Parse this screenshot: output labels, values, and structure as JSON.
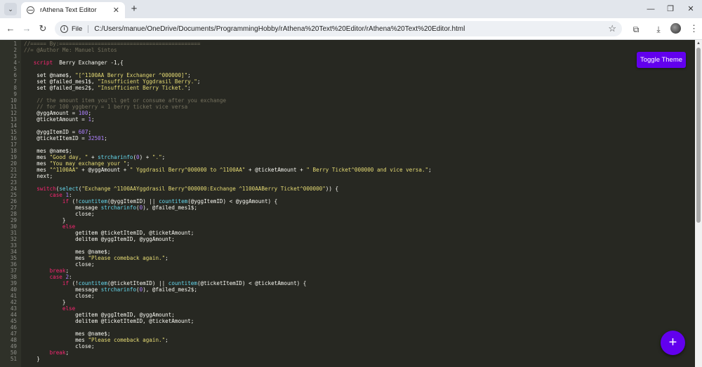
{
  "browser": {
    "tab_title": "rAthena Text Editor",
    "url_scheme": "File",
    "url": "C:/Users/manue/OneDrive/Documents/ProgrammingHobby/rAthena%20Text%20Editor/rAthena%20Text%20Editor.html",
    "tab_close": "✕",
    "new_tab": "+",
    "minimize": "—",
    "restore": "❐",
    "close": "✕",
    "back": "←",
    "forward": "→",
    "reload": "↻",
    "star": "☆",
    "extensions": "⧉",
    "downloads": "⤓",
    "menu": "⋮",
    "tab_search": "⌄",
    "info": "i"
  },
  "editor": {
    "toggle_theme_label": "Toggle Theme",
    "fab_label": "+",
    "scroll_up": "▲",
    "lines": [
      {
        "n": "1",
        "t": [
          [
            "c-comment",
            "//===== By:============================================"
          ]
        ]
      },
      {
        "n": "2",
        "t": [
          [
            "c-comment",
            "//= @Author Me: Manuel Sintos"
          ]
        ]
      },
      {
        "n": "3",
        "t": []
      },
      {
        "n": "4",
        "fold": "-",
        "t": [
          [
            "c-var",
            "   "
          ],
          [
            "c-kw",
            "script"
          ],
          [
            "c-var",
            "  Berry Exchanger -1,{"
          ]
        ]
      },
      {
        "n": "5",
        "t": []
      },
      {
        "n": "6",
        "t": [
          [
            "c-var",
            "    set @name$, "
          ],
          [
            "c-str",
            "\"[^1100AA Berry Exchanger ^000000]\""
          ],
          [
            "c-var",
            ";"
          ]
        ]
      },
      {
        "n": "7",
        "t": [
          [
            "c-var",
            "    set @failed_mes1$, "
          ],
          [
            "c-str",
            "\"Insufficient Yggdrasil Berry.\""
          ],
          [
            "c-var",
            ";"
          ]
        ]
      },
      {
        "n": "8",
        "t": [
          [
            "c-var",
            "    set @failed_mes2$, "
          ],
          [
            "c-str",
            "\"Insufficient Berry Ticket.\""
          ],
          [
            "c-var",
            ";"
          ]
        ]
      },
      {
        "n": "9",
        "t": []
      },
      {
        "n": "10",
        "t": [
          [
            "c-comment",
            "    // the amount item you'll get or consume after you exchange"
          ]
        ]
      },
      {
        "n": "11",
        "t": [
          [
            "c-comment",
            "    // for 100 yggberry = 1 berry ticket vice versa"
          ]
        ]
      },
      {
        "n": "12",
        "t": [
          [
            "c-var",
            "    @yggAmount = "
          ],
          [
            "c-num",
            "100"
          ],
          [
            "c-var",
            ";"
          ]
        ]
      },
      {
        "n": "13",
        "t": [
          [
            "c-var",
            "    @ticketAmount = "
          ],
          [
            "c-num",
            "1"
          ],
          [
            "c-var",
            ";"
          ]
        ]
      },
      {
        "n": "14",
        "t": []
      },
      {
        "n": "15",
        "t": [
          [
            "c-var",
            "    @yggItemID = "
          ],
          [
            "c-num",
            "607"
          ],
          [
            "c-var",
            ";"
          ]
        ]
      },
      {
        "n": "16",
        "t": [
          [
            "c-var",
            "    @ticketItemID = "
          ],
          [
            "c-num",
            "32501"
          ],
          [
            "c-var",
            ";"
          ]
        ]
      },
      {
        "n": "17",
        "t": []
      },
      {
        "n": "18",
        "t": [
          [
            "c-var",
            "    mes @name$;"
          ]
        ]
      },
      {
        "n": "19",
        "t": [
          [
            "c-var",
            "    mes "
          ],
          [
            "c-str",
            "\"Good day, \""
          ],
          [
            "c-var",
            " + "
          ],
          [
            "c-func",
            "strcharinfo"
          ],
          [
            "c-var",
            "("
          ],
          [
            "c-num",
            "0"
          ],
          [
            "c-var",
            ") + "
          ],
          [
            "c-str",
            "\".\""
          ],
          [
            "c-var",
            ";"
          ]
        ]
      },
      {
        "n": "20",
        "t": [
          [
            "c-var",
            "    mes "
          ],
          [
            "c-str",
            "\"You may exchange your \""
          ],
          [
            "c-var",
            ";"
          ]
        ]
      },
      {
        "n": "21",
        "t": [
          [
            "c-var",
            "    mes "
          ],
          [
            "c-str",
            "\"^1100AA\""
          ],
          [
            "c-var",
            " + @yggAmount + "
          ],
          [
            "c-str",
            "\" Yggdrasil Berry^000000 to ^1100AA\""
          ],
          [
            "c-var",
            " + @ticketAmount + "
          ],
          [
            "c-str",
            "\" Berry Ticket^000000 and vice versa.\""
          ],
          [
            "c-var",
            ";"
          ]
        ]
      },
      {
        "n": "22",
        "t": [
          [
            "c-var",
            "    next;"
          ]
        ]
      },
      {
        "n": "23",
        "t": []
      },
      {
        "n": "24",
        "t": [
          [
            "c-var",
            "    "
          ],
          [
            "c-kw",
            "switch"
          ],
          [
            "c-var",
            "("
          ],
          [
            "c-func",
            "select"
          ],
          [
            "c-var",
            "("
          ],
          [
            "c-str",
            "\"Exchange ^1100AAYggdrasil Berry^000000:Exchange ^1100AABerry Ticket^000000\""
          ],
          [
            "c-var",
            ")) {"
          ]
        ]
      },
      {
        "n": "25",
        "t": [
          [
            "c-var",
            "        "
          ],
          [
            "c-kw",
            "case"
          ],
          [
            "c-var",
            " "
          ],
          [
            "c-num",
            "1"
          ],
          [
            "c-var",
            ":"
          ]
        ]
      },
      {
        "n": "26",
        "t": [
          [
            "c-var",
            "            "
          ],
          [
            "c-kw",
            "if"
          ],
          [
            "c-var",
            " (!"
          ],
          [
            "c-func",
            "countitem"
          ],
          [
            "c-var",
            "(@yggItemID) || "
          ],
          [
            "c-func",
            "countitem"
          ],
          [
            "c-var",
            "(@yggItemID) < @yggAmount) {"
          ]
        ]
      },
      {
        "n": "27",
        "t": [
          [
            "c-var",
            "                message "
          ],
          [
            "c-func",
            "strcharinfo"
          ],
          [
            "c-var",
            "("
          ],
          [
            "c-num",
            "0"
          ],
          [
            "c-var",
            "), @failed_mes1$;"
          ]
        ]
      },
      {
        "n": "28",
        "t": [
          [
            "c-var",
            "                close;"
          ]
        ]
      },
      {
        "n": "29",
        "t": [
          [
            "c-var",
            "            }"
          ]
        ]
      },
      {
        "n": "30",
        "t": [
          [
            "c-var",
            "            "
          ],
          [
            "c-kw",
            "else"
          ]
        ]
      },
      {
        "n": "31",
        "t": [
          [
            "c-var",
            "                getitem @ticketItemID, @ticketAmount;"
          ]
        ]
      },
      {
        "n": "32",
        "t": [
          [
            "c-var",
            "                delitem @yggItemID, @yggAmount;"
          ]
        ]
      },
      {
        "n": "33",
        "t": []
      },
      {
        "n": "34",
        "t": [
          [
            "c-var",
            "                mes @name$;"
          ]
        ]
      },
      {
        "n": "35",
        "t": [
          [
            "c-var",
            "                mes "
          ],
          [
            "c-str",
            "\"Please comeback again.\""
          ],
          [
            "c-var",
            ";"
          ]
        ]
      },
      {
        "n": "36",
        "t": [
          [
            "c-var",
            "                close;"
          ]
        ]
      },
      {
        "n": "37",
        "t": [
          [
            "c-var",
            "        "
          ],
          [
            "c-kw",
            "break"
          ],
          [
            "c-var",
            ";"
          ]
        ]
      },
      {
        "n": "38",
        "t": [
          [
            "c-var",
            "        "
          ],
          [
            "c-kw",
            "case"
          ],
          [
            "c-var",
            " "
          ],
          [
            "c-num",
            "2"
          ],
          [
            "c-var",
            ":"
          ]
        ]
      },
      {
        "n": "39",
        "t": [
          [
            "c-var",
            "            "
          ],
          [
            "c-kw",
            "if"
          ],
          [
            "c-var",
            " (!"
          ],
          [
            "c-func",
            "countitem"
          ],
          [
            "c-var",
            "(@ticketItemID) || "
          ],
          [
            "c-func",
            "countitem"
          ],
          [
            "c-var",
            "(@ticketItemID) < @ticketAmount) {"
          ]
        ]
      },
      {
        "n": "40",
        "t": [
          [
            "c-var",
            "                message "
          ],
          [
            "c-func",
            "strcharinfo"
          ],
          [
            "c-var",
            "("
          ],
          [
            "c-num",
            "0"
          ],
          [
            "c-var",
            "), @failed_mes2$;"
          ]
        ]
      },
      {
        "n": "41",
        "t": [
          [
            "c-var",
            "                close;"
          ]
        ]
      },
      {
        "n": "42",
        "t": [
          [
            "c-var",
            "            }"
          ]
        ]
      },
      {
        "n": "43",
        "t": [
          [
            "c-var",
            "            "
          ],
          [
            "c-kw",
            "else"
          ]
        ]
      },
      {
        "n": "44",
        "t": [
          [
            "c-var",
            "                getitem @yggItemID, @yggAmount;"
          ]
        ]
      },
      {
        "n": "45",
        "t": [
          [
            "c-var",
            "                delitem @ticketItemID, @ticketAmount;"
          ]
        ]
      },
      {
        "n": "46",
        "t": []
      },
      {
        "n": "47",
        "t": [
          [
            "c-var",
            "                mes @name$;"
          ]
        ]
      },
      {
        "n": "48",
        "t": [
          [
            "c-var",
            "                mes "
          ],
          [
            "c-str",
            "\"Please comeback again.\""
          ],
          [
            "c-var",
            ";"
          ]
        ]
      },
      {
        "n": "49",
        "t": [
          [
            "c-var",
            "                close;"
          ]
        ]
      },
      {
        "n": "50",
        "t": [
          [
            "c-var",
            "        "
          ],
          [
            "c-kw",
            "break"
          ],
          [
            "c-var",
            ";"
          ]
        ]
      },
      {
        "n": "51",
        "t": [
          [
            "c-var",
            "    }"
          ]
        ]
      }
    ]
  },
  "colors": {
    "editor_bg": "#272822",
    "accent": "#6200ee",
    "keyword": "#f92672",
    "string": "#e6db74",
    "number": "#ae81ff",
    "function": "#66d9ef",
    "comment": "#75715e"
  }
}
